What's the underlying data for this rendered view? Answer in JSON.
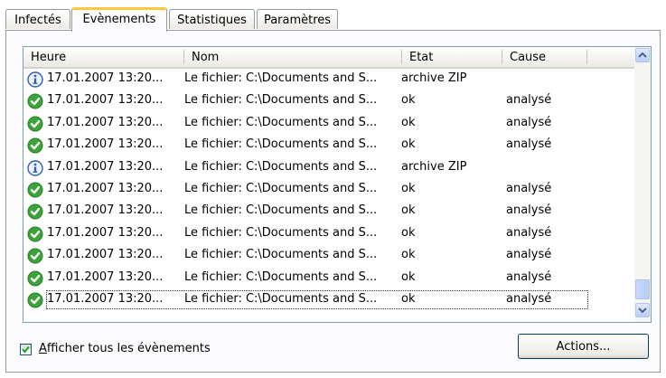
{
  "tabs": [
    {
      "label": "Infectés",
      "active": false
    },
    {
      "label": "Evènements",
      "active": true
    },
    {
      "label": "Statistiques",
      "active": false
    },
    {
      "label": "Paramètres",
      "active": false
    }
  ],
  "columns": [
    "Heure",
    "Nom",
    "Etat",
    "Cause"
  ],
  "rows": [
    {
      "icon": "info",
      "heure": "17.01.2007 13:20...",
      "nom": "Le fichier: C:\\Documents and S...",
      "etat": "archive ZIP",
      "cause": ""
    },
    {
      "icon": "ok",
      "heure": "17.01.2007 13:20...",
      "nom": "Le fichier: C:\\Documents and S...",
      "etat": "ok",
      "cause": "analysé"
    },
    {
      "icon": "ok",
      "heure": "17.01.2007 13:20...",
      "nom": "Le fichier: C:\\Documents and S...",
      "etat": "ok",
      "cause": "analysé"
    },
    {
      "icon": "ok",
      "heure": "17.01.2007 13:20...",
      "nom": "Le fichier: C:\\Documents and S...",
      "etat": "ok",
      "cause": "analysé"
    },
    {
      "icon": "info",
      "heure": "17.01.2007 13:20...",
      "nom": "Le fichier: C:\\Documents and S...",
      "etat": "archive ZIP",
      "cause": ""
    },
    {
      "icon": "ok",
      "heure": "17.01.2007 13:20...",
      "nom": "Le fichier: C:\\Documents and S...",
      "etat": "ok",
      "cause": "analysé"
    },
    {
      "icon": "ok",
      "heure": "17.01.2007 13:20...",
      "nom": "Le fichier: C:\\Documents and S...",
      "etat": "ok",
      "cause": "analysé"
    },
    {
      "icon": "ok",
      "heure": "17.01.2007 13:20...",
      "nom": "Le fichier: C:\\Documents and S...",
      "etat": "ok",
      "cause": "analysé"
    },
    {
      "icon": "ok",
      "heure": "17.01.2007 13:20...",
      "nom": "Le fichier: C:\\Documents and S...",
      "etat": "ok",
      "cause": "analysé"
    },
    {
      "icon": "ok",
      "heure": "17.01.2007 13:20...",
      "nom": "Le fichier: C:\\Documents and S...",
      "etat": "ok",
      "cause": "analysé"
    },
    {
      "icon": "ok",
      "heure": "17.01.2007 13:20...",
      "nom": "Le fichier: C:\\Documents and S...",
      "etat": "ok",
      "cause": "analysé",
      "focused": true
    }
  ],
  "show_all_events": {
    "prefix": "A",
    "rest": "fficher tous les évènements",
    "checked": true
  },
  "actions_button": "Actions...",
  "colors": {
    "ok": "#3aa33a",
    "info": "#2f5fb8",
    "tab_highlight": "#ffc83c"
  }
}
